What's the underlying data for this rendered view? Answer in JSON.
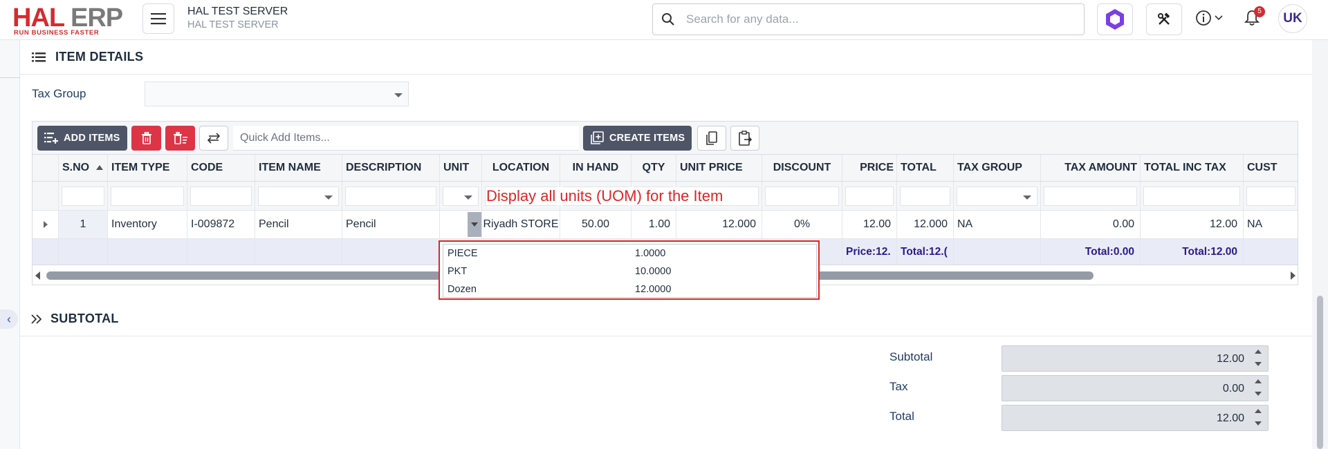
{
  "header": {
    "logo_text": "HAL ERP",
    "logo_hal": "HAL",
    "logo_erp": " ERP",
    "logo_tagline": "RUN BUSINESS FASTER",
    "server_title": "HAL TEST SERVER",
    "server_subtitle": "HAL TEST SERVER",
    "search_placeholder": "Search for any data...",
    "notification_count": "5",
    "user_initials": "UK"
  },
  "item_details": {
    "section_title": "ITEM DETAILS",
    "tax_group_label": "Tax Group",
    "tax_group_value": ""
  },
  "grid": {
    "toolbar": {
      "add_items_label": "ADD ITEMS",
      "create_items_label": "CREATE ITEMS",
      "quick_add_placeholder": "Quick Add Items..."
    },
    "columns": [
      "S.NO",
      "ITEM TYPE",
      "CODE",
      "ITEM NAME",
      "DESCRIPTION",
      "UNIT",
      "LOCATION",
      "IN HAND",
      "QTY",
      "UNIT PRICE",
      "DISCOUNT",
      "PRICE",
      "TOTAL",
      "TAX GROUP",
      "TAX AMOUNT",
      "TOTAL INC TAX",
      "CUST"
    ],
    "rows": [
      {
        "sno": "1",
        "item_type": "Inventory",
        "code": "I-009872",
        "item_name": "Pencil",
        "description": "Pencil",
        "unit": "",
        "location": "Riyadh STORE",
        "in_hand": "50.00",
        "qty": "1.00",
        "unit_price": "12.000",
        "discount": "0%",
        "price": "12.00",
        "total": "12.000",
        "tax_group": "NA",
        "tax_amount": "0.00",
        "total_inc_tax": "12.00",
        "cust": "NA"
      }
    ],
    "summary": {
      "price": "Price:12.",
      "total": "Total:12.(",
      "tax_amount": "Total:0.00",
      "total_inc_tax": "Total:12.00"
    },
    "sort_column": "S.NO",
    "sort_direction": "ascending"
  },
  "uom_popup": {
    "units": [
      {
        "name": "PIECE",
        "factor": "1.0000"
      },
      {
        "name": "PKT",
        "factor": "10.0000"
      },
      {
        "name": "Dozen",
        "factor": "12.0000"
      }
    ]
  },
  "annotation": "Display all units (UOM) for the Item",
  "subtotal": {
    "section_title": "SUBTOTAL",
    "subtotal_label": "Subtotal",
    "subtotal_value": "12.00",
    "tax_label": "Tax",
    "tax_value": "0.00",
    "total_label": "Total",
    "total_value": "12.00"
  },
  "colors": {
    "brand_red": "#d52b30",
    "dark_button": "#4d5566",
    "danger_button": "#dc3545",
    "annotation_red": "#e02424",
    "summary_text": "#2a1a8a"
  }
}
